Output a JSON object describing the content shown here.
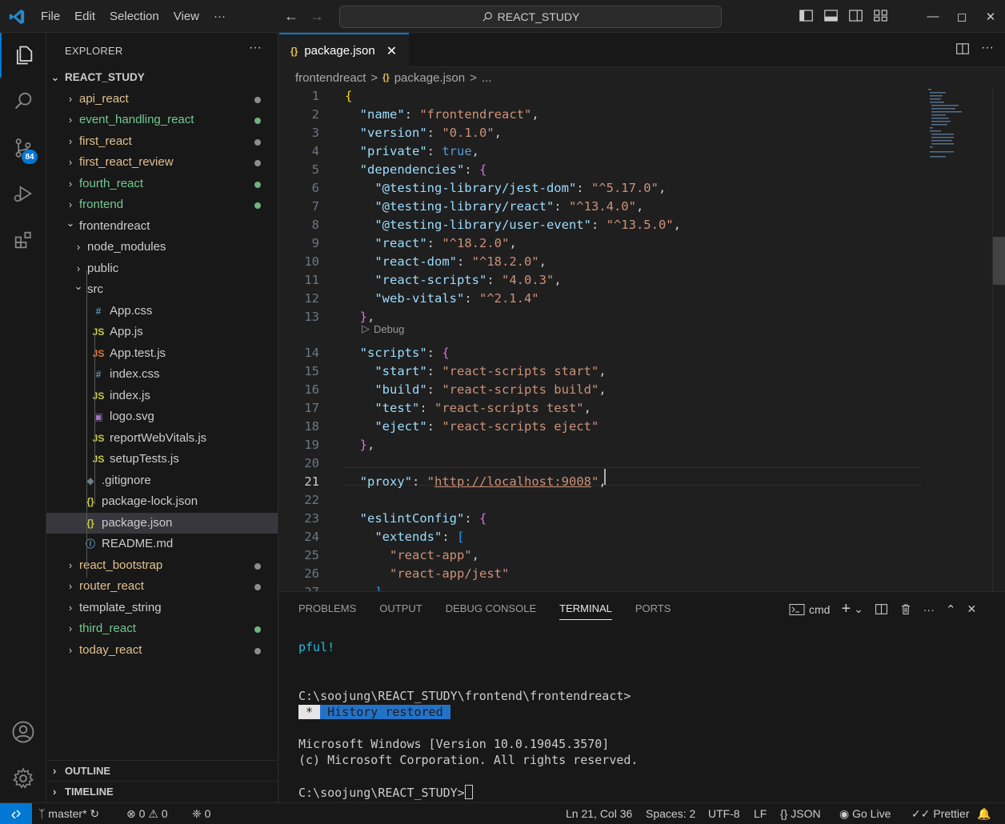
{
  "titlebar": {
    "menu": [
      "File",
      "Edit",
      "Selection",
      "View",
      "···"
    ],
    "search_text": "REACT_STUDY"
  },
  "activity": {
    "scm_badge": "84"
  },
  "sidebar": {
    "title": "EXPLORER",
    "more": "···",
    "root": "REACT_STUDY",
    "items": [
      {
        "label": "api_react",
        "depth": 0,
        "kind": "folder",
        "open": false,
        "color": "mod",
        "dot": "#8c8c8c"
      },
      {
        "label": "event_handling_react",
        "depth": 0,
        "kind": "folder",
        "open": false,
        "color": "green",
        "dot": "#6fb380"
      },
      {
        "label": "first_react",
        "depth": 0,
        "kind": "folder",
        "open": false,
        "color": "mod",
        "dot": "#8c8c8c"
      },
      {
        "label": "first_react_review",
        "depth": 0,
        "kind": "folder",
        "open": false,
        "color": "mod",
        "dot": "#8c8c8c"
      },
      {
        "label": "fourth_react",
        "depth": 0,
        "kind": "folder",
        "open": false,
        "color": "green",
        "dot": "#6fb380"
      },
      {
        "label": "frontend",
        "depth": 0,
        "kind": "folder",
        "open": false,
        "color": "green",
        "dot": "#6fb380"
      },
      {
        "label": "frontendreact",
        "depth": 0,
        "kind": "folder",
        "open": true,
        "color": "def"
      },
      {
        "label": "node_modules",
        "depth": 1,
        "kind": "folder",
        "open": false,
        "color": "def"
      },
      {
        "label": "public",
        "depth": 1,
        "kind": "folder",
        "open": false,
        "color": "def"
      },
      {
        "label": "src",
        "depth": 1,
        "kind": "folder",
        "open": true,
        "color": "def"
      },
      {
        "label": "App.css",
        "depth": 2,
        "kind": "file",
        "icon": "#",
        "icon_color": "#519aba",
        "color": "def"
      },
      {
        "label": "App.js",
        "depth": 2,
        "kind": "file",
        "icon": "JS",
        "icon_color": "#cbcb41",
        "color": "def"
      },
      {
        "label": "App.test.js",
        "depth": 2,
        "kind": "file",
        "icon": "JS",
        "icon_color": "#e37933",
        "color": "def"
      },
      {
        "label": "index.css",
        "depth": 2,
        "kind": "file",
        "icon": "#",
        "icon_color": "#519aba",
        "color": "def"
      },
      {
        "label": "index.js",
        "depth": 2,
        "kind": "file",
        "icon": "JS",
        "icon_color": "#cbcb41",
        "color": "def"
      },
      {
        "label": "logo.svg",
        "depth": 2,
        "kind": "file",
        "icon": "▣",
        "icon_color": "#a074c4",
        "color": "def"
      },
      {
        "label": "reportWebVitals.js",
        "depth": 2,
        "kind": "file",
        "icon": "JS",
        "icon_color": "#cbcb41",
        "color": "def"
      },
      {
        "label": "setupTests.js",
        "depth": 2,
        "kind": "file",
        "icon": "JS",
        "icon_color": "#cbcb41",
        "color": "def"
      },
      {
        "label": ".gitignore",
        "depth": 1,
        "kind": "file",
        "icon": "◆",
        "icon_color": "#6d8086",
        "color": "def"
      },
      {
        "label": "package-lock.json",
        "depth": 1,
        "kind": "file",
        "icon": "{}",
        "icon_color": "#cbcb41",
        "color": "def"
      },
      {
        "label": "package.json",
        "depth": 1,
        "kind": "file",
        "icon": "{}",
        "icon_color": "#cbcb41",
        "color": "def",
        "selected": true
      },
      {
        "label": "README.md",
        "depth": 1,
        "kind": "file",
        "icon": "ⓘ",
        "icon_color": "#519aba",
        "color": "def"
      },
      {
        "label": "react_bootstrap",
        "depth": 0,
        "kind": "folder",
        "open": false,
        "color": "mod",
        "dot": "#8c8c8c"
      },
      {
        "label": "router_react",
        "depth": 0,
        "kind": "folder",
        "open": false,
        "color": "mod",
        "dot": "#8c8c8c"
      },
      {
        "label": "template_string",
        "depth": 0,
        "kind": "folder",
        "open": false,
        "color": "def"
      },
      {
        "label": "third_react",
        "depth": 0,
        "kind": "folder",
        "open": false,
        "color": "green",
        "dot": "#6fb380"
      },
      {
        "label": "today_react",
        "depth": 0,
        "kind": "folder",
        "open": false,
        "color": "mod",
        "dot": "#8c8c8c"
      }
    ],
    "outline": "OUTLINE",
    "timeline": "TIMELINE"
  },
  "editor": {
    "tab_icon": "{}",
    "tab_label": "package.json",
    "tab_close": "✕",
    "breadcrumb": [
      "frontendreact",
      "package.json",
      "..."
    ],
    "breadcrumb_sep": ">",
    "codelens": "Debug",
    "current_line": 21,
    "lines": [
      [
        [
          "{",
          "b1"
        ]
      ],
      [
        [
          "  ",
          "p"
        ],
        [
          "\"name\"",
          "k"
        ],
        [
          ": ",
          "p"
        ],
        [
          "\"frontendreact\"",
          "s"
        ],
        [
          ",",
          "p"
        ]
      ],
      [
        [
          "  ",
          "p"
        ],
        [
          "\"version\"",
          "k"
        ],
        [
          ": ",
          "p"
        ],
        [
          "\"0.1.0\"",
          "s"
        ],
        [
          ",",
          "p"
        ]
      ],
      [
        [
          "  ",
          "p"
        ],
        [
          "\"private\"",
          "k"
        ],
        [
          ": ",
          "p"
        ],
        [
          "true",
          "n"
        ],
        [
          ",",
          "p"
        ]
      ],
      [
        [
          "  ",
          "p"
        ],
        [
          "\"dependencies\"",
          "k"
        ],
        [
          ": ",
          "p"
        ],
        [
          "{",
          "b2"
        ]
      ],
      [
        [
          "    ",
          "p"
        ],
        [
          "\"@testing-library/jest-dom\"",
          "k"
        ],
        [
          ": ",
          "p"
        ],
        [
          "\"^5.17.0\"",
          "s"
        ],
        [
          ",",
          "p"
        ]
      ],
      [
        [
          "    ",
          "p"
        ],
        [
          "\"@testing-library/react\"",
          "k"
        ],
        [
          ": ",
          "p"
        ],
        [
          "\"^13.4.0\"",
          "s"
        ],
        [
          ",",
          "p"
        ]
      ],
      [
        [
          "    ",
          "p"
        ],
        [
          "\"@testing-library/user-event\"",
          "k"
        ],
        [
          ": ",
          "p"
        ],
        [
          "\"^13.5.0\"",
          "s"
        ],
        [
          ",",
          "p"
        ]
      ],
      [
        [
          "    ",
          "p"
        ],
        [
          "\"react\"",
          "k"
        ],
        [
          ": ",
          "p"
        ],
        [
          "\"^18.2.0\"",
          "s"
        ],
        [
          ",",
          "p"
        ]
      ],
      [
        [
          "    ",
          "p"
        ],
        [
          "\"react-dom\"",
          "k"
        ],
        [
          ": ",
          "p"
        ],
        [
          "\"^18.2.0\"",
          "s"
        ],
        [
          ",",
          "p"
        ]
      ],
      [
        [
          "    ",
          "p"
        ],
        [
          "\"react-scripts\"",
          "k"
        ],
        [
          ": ",
          "p"
        ],
        [
          "\"4.0.3\"",
          "s"
        ],
        [
          ",",
          "p"
        ]
      ],
      [
        [
          "    ",
          "p"
        ],
        [
          "\"web-vitals\"",
          "k"
        ],
        [
          ": ",
          "p"
        ],
        [
          "\"^2.1.4\"",
          "s"
        ]
      ],
      [
        [
          "  ",
          "p"
        ],
        [
          "}",
          "b2"
        ],
        [
          ",",
          "p"
        ]
      ],
      [
        [
          "  ",
          "p"
        ],
        [
          "\"scripts\"",
          "k"
        ],
        [
          ": ",
          "p"
        ],
        [
          "{",
          "b2"
        ]
      ],
      [
        [
          "    ",
          "p"
        ],
        [
          "\"start\"",
          "k"
        ],
        [
          ": ",
          "p"
        ],
        [
          "\"react-scripts start\"",
          "s"
        ],
        [
          ",",
          "p"
        ]
      ],
      [
        [
          "    ",
          "p"
        ],
        [
          "\"build\"",
          "k"
        ],
        [
          ": ",
          "p"
        ],
        [
          "\"react-scripts build\"",
          "s"
        ],
        [
          ",",
          "p"
        ]
      ],
      [
        [
          "    ",
          "p"
        ],
        [
          "\"test\"",
          "k"
        ],
        [
          ": ",
          "p"
        ],
        [
          "\"react-scripts test\"",
          "s"
        ],
        [
          ",",
          "p"
        ]
      ],
      [
        [
          "    ",
          "p"
        ],
        [
          "\"eject\"",
          "k"
        ],
        [
          ": ",
          "p"
        ],
        [
          "\"react-scripts eject\"",
          "s"
        ]
      ],
      [
        [
          "  ",
          "p"
        ],
        [
          "}",
          "b2"
        ],
        [
          ",",
          "p"
        ]
      ],
      [
        [
          "",
          "p"
        ]
      ],
      [
        [
          "  ",
          "p"
        ],
        [
          "\"proxy\"",
          "k"
        ],
        [
          ": ",
          "p"
        ],
        [
          "\"",
          "s"
        ],
        [
          "http://localhost:9008",
          "s url"
        ],
        [
          "\"",
          "s"
        ],
        [
          ",",
          "p"
        ]
      ],
      [
        [
          "",
          "p"
        ]
      ],
      [
        [
          "  ",
          "p"
        ],
        [
          "\"eslintConfig\"",
          "k"
        ],
        [
          ": ",
          "p"
        ],
        [
          "{",
          "b2"
        ]
      ],
      [
        [
          "    ",
          "p"
        ],
        [
          "\"extends\"",
          "k"
        ],
        [
          ": ",
          "p"
        ],
        [
          "[",
          "b3"
        ]
      ],
      [
        [
          "      ",
          "p"
        ],
        [
          "\"react-app\"",
          "s"
        ],
        [
          ",",
          "p"
        ]
      ],
      [
        [
          "      ",
          "p"
        ],
        [
          "\"react-app/jest\"",
          "s"
        ]
      ],
      [
        [
          "    ",
          "p"
        ],
        [
          "]",
          "b3"
        ]
      ]
    ]
  },
  "panel": {
    "tabs": [
      "PROBLEMS",
      "OUTPUT",
      "DEBUG CONSOLE",
      "TERMINAL",
      "PORTS"
    ],
    "active_tab": "TERMINAL",
    "shell": "cmd",
    "terminal": {
      "line1": "pful!",
      "prompt1": "C:\\soojung\\REACT_STUDY\\frontend\\frontendreact>",
      "history_star": " * ",
      "history": " History restored ",
      "ms1": "Microsoft Windows [Version 10.0.19045.3570]",
      "ms2": "(c) Microsoft Corporation. All rights reserved.",
      "prompt2": "C:\\soojung\\REACT_STUDY>"
    }
  },
  "status": {
    "branch": "master*",
    "errors": "0",
    "warnings": "0",
    "ports": "0",
    "position": "Ln 21, Col 36",
    "spaces": "Spaces: 2",
    "encoding": "UTF-8",
    "eol": "LF",
    "language": "JSON",
    "live": "Go Live",
    "prettier": "Prettier"
  }
}
